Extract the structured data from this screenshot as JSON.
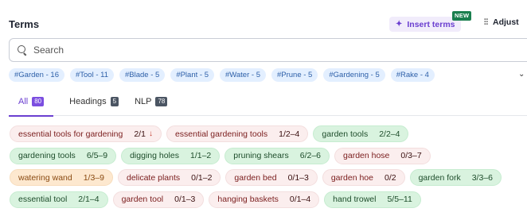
{
  "header": {
    "title": "Terms",
    "insert_label": "Insert terms",
    "new_badge": "NEW",
    "adjust_label": "Adjust"
  },
  "search": {
    "placeholder": "Search",
    "value": ""
  },
  "filters": [
    "#Garden - 16",
    "#Tool - 11",
    "#Blade - 5",
    "#Plant - 5",
    "#Water - 5",
    "#Prune - 5",
    "#Gardening - 5",
    "#Rake - 4"
  ],
  "tabs": [
    {
      "label": "All",
      "count": "80",
      "active": true
    },
    {
      "label": "Headings",
      "count": "5",
      "active": false
    },
    {
      "label": "NLP",
      "count": "78",
      "active": false
    }
  ],
  "terms": [
    [
      {
        "text": "essential tools for gardening",
        "count": "2/1",
        "status": "red",
        "arrow": "↓"
      },
      {
        "text": "essential gardening tools",
        "count": "1/2–4",
        "status": "red"
      },
      {
        "text": "garden tools",
        "count": "2/2–4",
        "status": "green"
      }
    ],
    [
      {
        "text": "gardening tools",
        "count": "6/5–9",
        "status": "green"
      },
      {
        "text": "digging holes",
        "count": "1/1–2",
        "status": "green"
      },
      {
        "text": "pruning shears",
        "count": "6/2–6",
        "status": "green"
      },
      {
        "text": "garden hose",
        "count": "0/3–7",
        "status": "red"
      }
    ],
    [
      {
        "text": "watering wand",
        "count": "1/3–9",
        "status": "orange"
      },
      {
        "text": "delicate plants",
        "count": "0/1–2",
        "status": "red"
      },
      {
        "text": "garden bed",
        "count": "0/1–3",
        "status": "red"
      },
      {
        "text": "garden hoe",
        "count": "0/2",
        "status": "red"
      },
      {
        "text": "garden fork",
        "count": "3/3–6",
        "status": "green"
      }
    ],
    [
      {
        "text": "essential tool",
        "count": "2/1–4",
        "status": "green"
      },
      {
        "text": "garden tool",
        "count": "0/1–3",
        "status": "red"
      },
      {
        "text": "hanging baskets",
        "count": "0/1–4",
        "status": "red"
      },
      {
        "text": "hand trowel",
        "count": "5/5–11",
        "status": "green"
      }
    ]
  ],
  "colors": {
    "accent": "#6b3fd0",
    "found": "#d9f3df",
    "missing": "#fbeeee",
    "partial": "#fde8cf",
    "filter": "#e3efff"
  }
}
